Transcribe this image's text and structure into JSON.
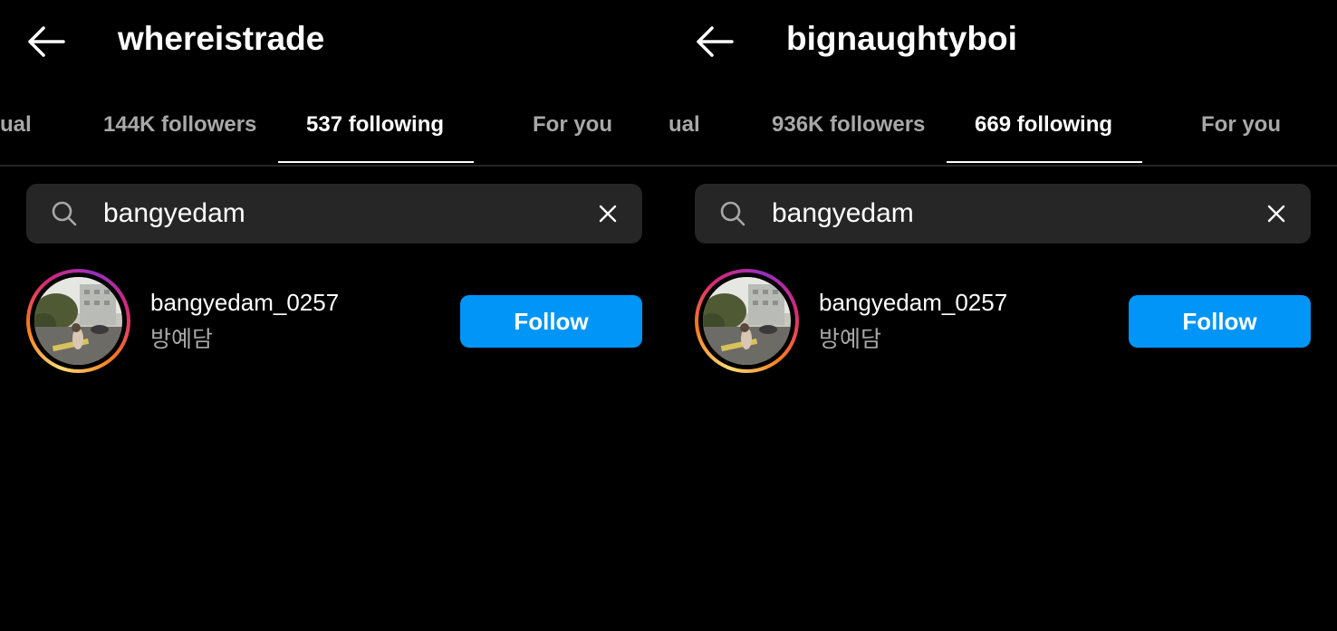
{
  "panels": [
    {
      "title": "whereistrade",
      "tabs": {
        "partial": "ual",
        "followers": "144K followers",
        "following": "537 following",
        "for_you": "For you"
      },
      "search": {
        "value": "bangyedam"
      },
      "result": {
        "username": "bangyedam_0257",
        "full_name": "방예담",
        "follow_label": "Follow"
      }
    },
    {
      "title": "bignaughtyboi",
      "tabs": {
        "partial": "ual",
        "followers": "936K followers",
        "following": "669 following",
        "for_you": "For you"
      },
      "search": {
        "value": "bangyedam"
      },
      "result": {
        "username": "bangyedam_0257",
        "full_name": "방예담",
        "follow_label": "Follow"
      }
    }
  ],
  "icons": [
    "back-arrow-icon",
    "search-icon",
    "close-icon"
  ],
  "colors": {
    "background": "#000000",
    "search_bg": "#262626",
    "follow_button": "#0095f6",
    "inactive_tab": "#a8a8a8"
  }
}
